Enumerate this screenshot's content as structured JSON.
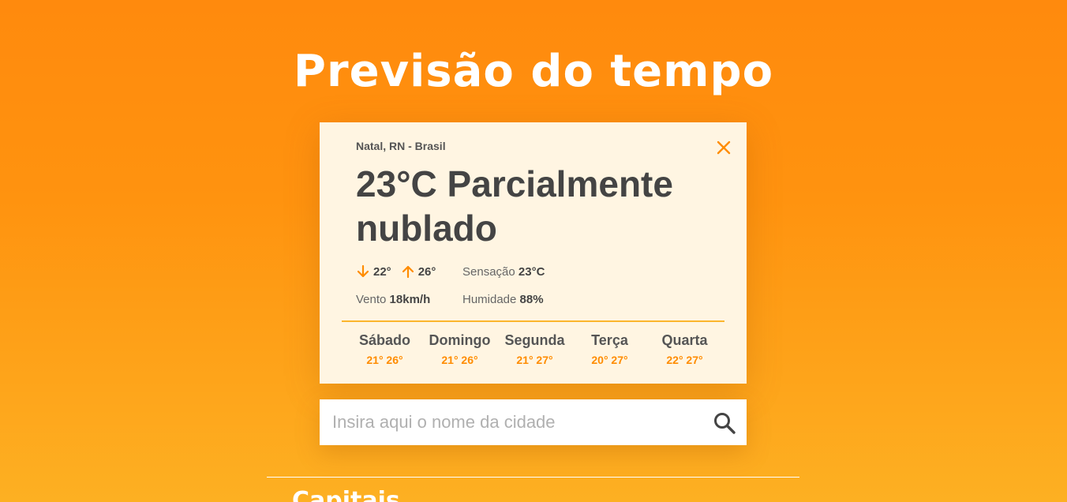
{
  "page": {
    "title": "Previsão do tempo",
    "background_colors": [
      "#ff8a0d",
      "#fdb022"
    ]
  },
  "current": {
    "location": "Natal, RN - Brasil",
    "headline": "23°C Parcialmente nublado",
    "min": "22°",
    "max": "26°",
    "feels_like_label": "Sensação",
    "feels_like_value": "23°C",
    "wind_label": "Vento",
    "wind_value": "18km/h",
    "humidity_label": "Humidade",
    "humidity_value": "88%"
  },
  "forecast": [
    {
      "day": "Sábado",
      "temps": "21° 26°"
    },
    {
      "day": "Domingo",
      "temps": "21° 26°"
    },
    {
      "day": "Segunda",
      "temps": "21° 27°"
    },
    {
      "day": "Terça",
      "temps": "20° 27°"
    },
    {
      "day": "Quarta",
      "temps": "22° 27°"
    }
  ],
  "search": {
    "placeholder": "Insira aqui o nome da cidade",
    "value": ""
  },
  "capitals": {
    "title": "Capitais"
  },
  "icons": {
    "close": "close-icon",
    "search": "search-icon",
    "min": "arrow-down-icon",
    "max": "arrow-up-icon"
  },
  "colors": {
    "accent": "#ff8c00",
    "card_bg": "#fff5e2",
    "divider": "#fbb52d"
  }
}
